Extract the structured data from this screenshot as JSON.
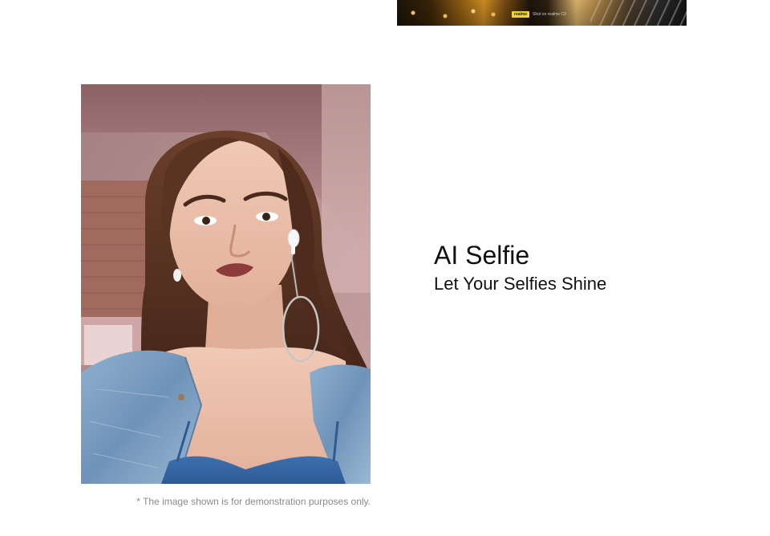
{
  "top_photo": {
    "watermark_brand": "realme",
    "watermark_text": "Shot on realme C3"
  },
  "feature": {
    "title": "AI Selfie",
    "subtitle": "Let Your Selfies Shine"
  },
  "disclaimer": "* The image shown is for demonstration purposes only."
}
